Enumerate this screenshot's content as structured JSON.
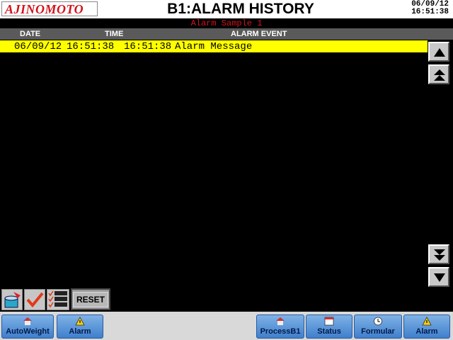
{
  "header": {
    "logo_text": "AJINOMOTO",
    "title": "B1:ALARM HISTORY",
    "date": "06/09/12",
    "time": "16:51:38",
    "subtitle": "Alarm Sample 1"
  },
  "columns": {
    "date": "DATE",
    "time": "TIME",
    "event": "ALARM EVENT"
  },
  "alarms": [
    {
      "date": "06/09/12",
      "time": "16:51:38",
      "time2": "16:51:38",
      "message": "Alarm Message"
    }
  ],
  "toolbar": {
    "reset_label": "RESET"
  },
  "nav": {
    "items": [
      {
        "label": "AutoWeight",
        "icon": "house-icon"
      },
      {
        "label": "Alarm",
        "icon": "warning-icon"
      },
      {
        "label": "ProcessB1",
        "icon": "house-icon"
      },
      {
        "label": "Status",
        "icon": "calendar-icon"
      },
      {
        "label": "Formular",
        "icon": "clock-icon"
      },
      {
        "label": "Alarm",
        "icon": "warning-icon"
      }
    ]
  },
  "colors": {
    "row_highlight": "#ffff00",
    "subtitle": "#d0141b",
    "nav_button": "#5a93d8",
    "logo": "#d4121b"
  }
}
